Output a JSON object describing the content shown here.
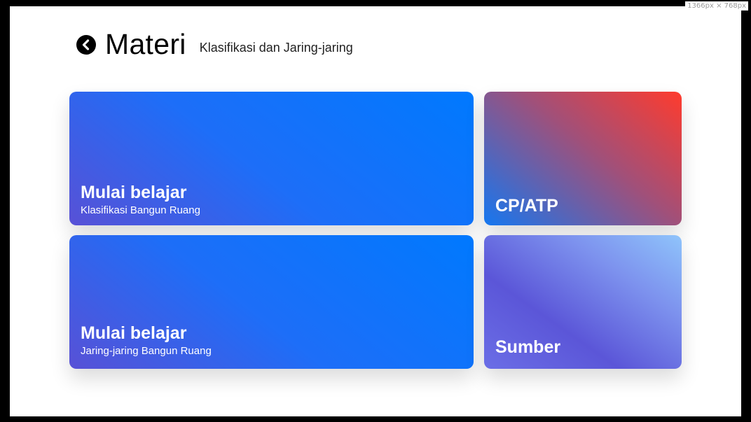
{
  "viewport_badge": "1366px × 768px",
  "header": {
    "back_icon": "chevron-left-circle-icon",
    "title": "Materi",
    "subtitle": "Klasifikasi dan Jaring-jaring"
  },
  "cards": [
    {
      "heading": "Mulai belajar",
      "subheading": "Klasifikasi Bangun Ruang"
    },
    {
      "heading": "Mulai belajar",
      "subheading": "Jaring-jaring Bangun Ruang"
    },
    {
      "heading": "CP/ATP"
    },
    {
      "heading": "Sumber"
    }
  ],
  "colors": {
    "primary_blue": "#0079fe",
    "purple": "#5851d6",
    "red": "#ff3b2d",
    "light_blue": "#8fc4fb"
  }
}
